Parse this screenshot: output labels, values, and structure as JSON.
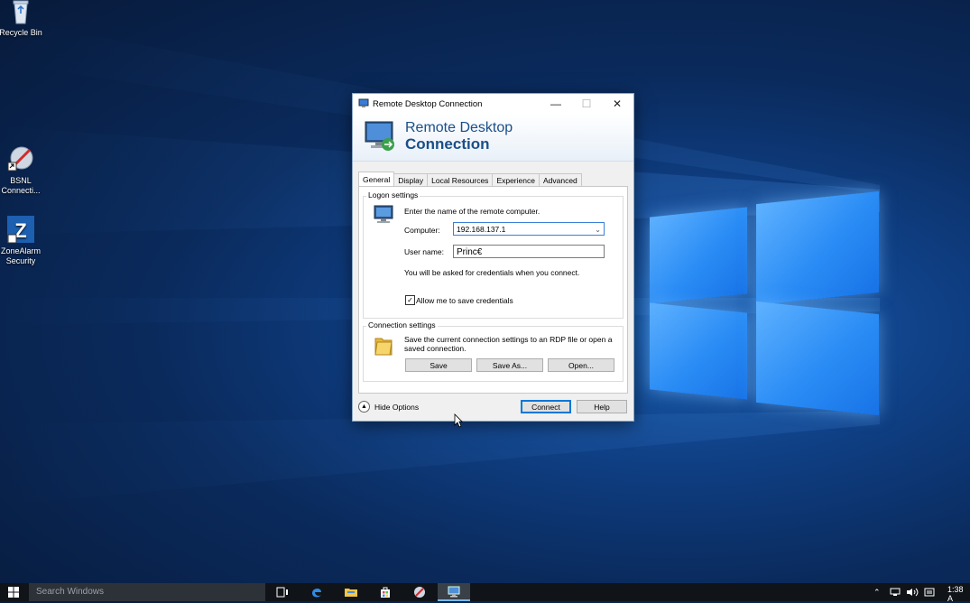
{
  "desktop": {
    "icons": [
      {
        "label": "Recycle Bin"
      },
      {
        "label": "BSNL\nConnecti..."
      },
      {
        "label": "ZoneAlarm\nSecurity"
      }
    ],
    "accent_color": "#2a8cf5"
  },
  "window": {
    "title": "Remote Desktop Connection",
    "controls": {
      "minimize": "—",
      "maximize": "☐",
      "close": "✕"
    },
    "banner": {
      "line1": "Remote Desktop",
      "line2": "Connection"
    },
    "tabs": [
      "General",
      "Display",
      "Local Resources",
      "Experience",
      "Advanced"
    ],
    "active_tab": "General",
    "logon": {
      "group_label": "Logon settings",
      "instruction": "Enter the name of the remote computer.",
      "computer_label": "Computer:",
      "computer_value": "192.168.137.1",
      "username_label": "User name:",
      "username_value": "Princ€",
      "note": "You will be asked for credentials when you connect.",
      "allow_save_label": "Allow me to save credentials",
      "allow_save_checked": true
    },
    "connection": {
      "group_label": "Connection settings",
      "description": "Save the current connection settings to an RDP file or open a saved connection.",
      "save_button": "Save",
      "save_as_button": "Save As...",
      "open_button": "Open..."
    },
    "footer": {
      "hide_options": "Hide Options",
      "connect_button": "Connect",
      "help_button": "Help"
    }
  },
  "taskbar": {
    "search_placeholder": "Search Windows",
    "clock": "1:38 A",
    "apps": [
      "task-view-icon",
      "edge-icon",
      "file-explorer-icon",
      "store-icon",
      "app-icon",
      "remote-desktop-icon"
    ]
  }
}
